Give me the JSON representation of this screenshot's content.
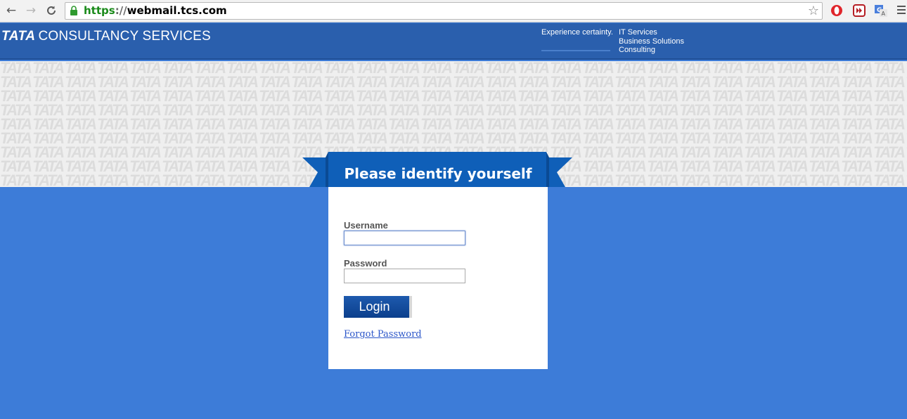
{
  "browser": {
    "url_scheme": "https",
    "url_separator": "://",
    "url_host": "webmail.tcs.com",
    "icons": {
      "back": "back-arrow-icon",
      "forward": "forward-arrow-icon",
      "reload": "reload-icon",
      "lock": "lock-icon",
      "bookmark": "star-icon",
      "menu": "hamburger-menu-icon"
    }
  },
  "header": {
    "logo_tata": "TATA",
    "logo_text": "CONSULTANCY SERVICES",
    "tagline": "Experience certainty.",
    "services": [
      "IT Services",
      "Business Solutions",
      "Consulting"
    ]
  },
  "login": {
    "title": "Please identify yourself",
    "username_label": "Username",
    "username_value": "",
    "password_label": "Password",
    "password_value": "",
    "login_button": "Login",
    "forgot_link": "Forgot Password"
  },
  "colors": {
    "header_bg": "#2a5fad",
    "page_bg": "#3d7cd8",
    "ribbon": "#0f5fb8",
    "link": "#2b56c9"
  }
}
